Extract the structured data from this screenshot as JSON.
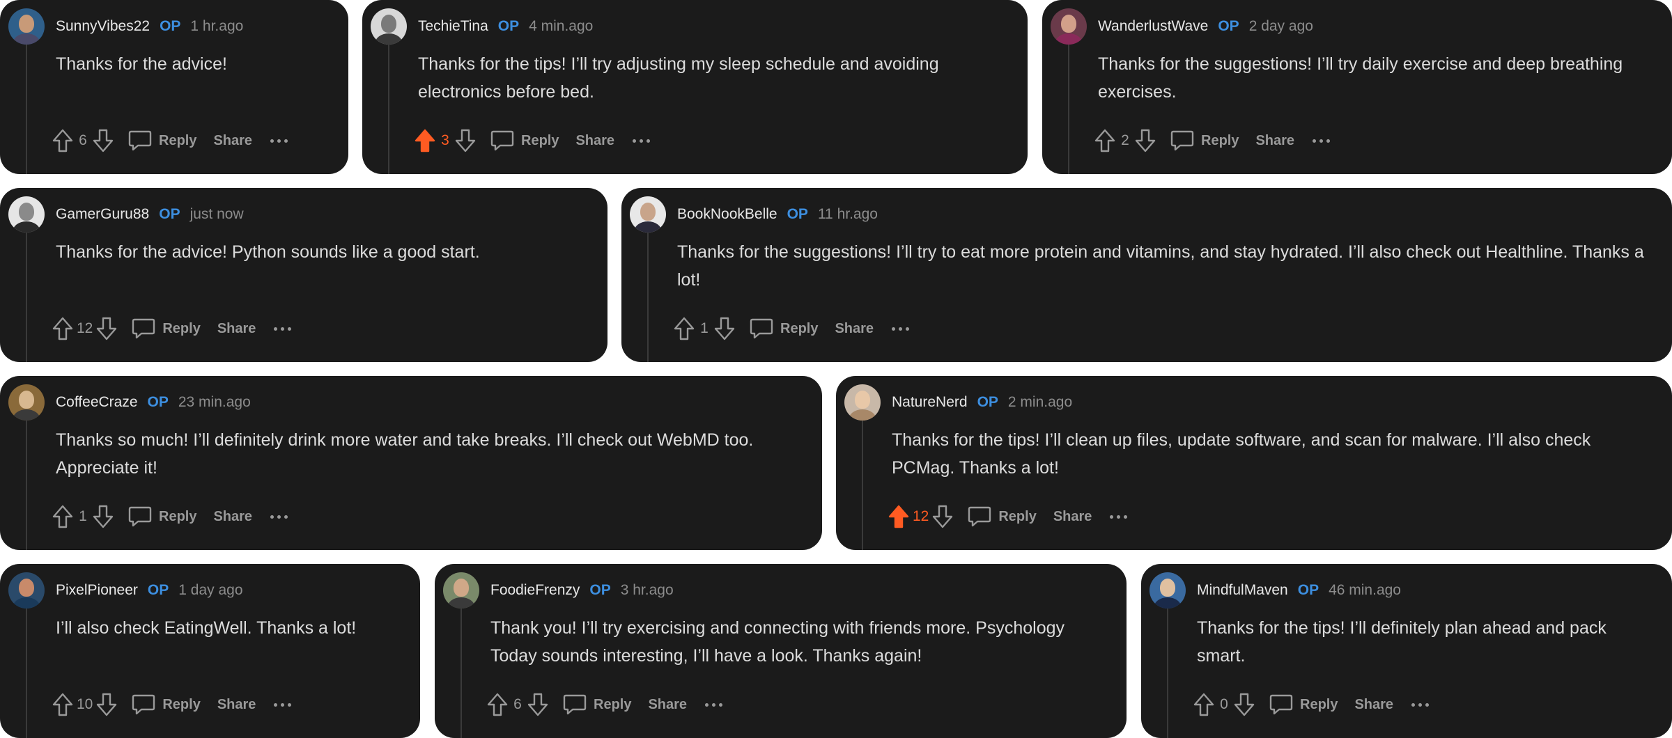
{
  "labels": {
    "op": "OP",
    "reply": "Reply",
    "share": "Share"
  },
  "colors": {
    "card_bg": "#1b1b1b",
    "op_badge": "#3d8fe0",
    "upvoted": "#ff5b22",
    "muted": "#9a9a9a"
  },
  "comments": [
    {
      "username": "SunnyVibes22",
      "time": "1 hr.ago",
      "text": "Thanks for the advice!",
      "votes": "6",
      "upvoted": false
    },
    {
      "username": "TechieTina",
      "time": "4 min.ago",
      "text": "Thanks for the tips! I’ll try adjusting my sleep schedule and avoiding electronics before bed.",
      "votes": "3",
      "upvoted": true
    },
    {
      "username": "WanderlustWave",
      "time": "2 day ago",
      "text": "Thanks for the suggestions! I’ll try daily exercise and deep breathing exercises.",
      "votes": "2",
      "upvoted": false
    },
    {
      "username": "GamerGuru88",
      "time": "just now",
      "text": "Thanks for the advice! Python sounds like a good start.",
      "votes": "12",
      "upvoted": false
    },
    {
      "username": "BookNookBelle",
      "time": "11 hr.ago",
      "text": "Thanks for the suggestions! I’ll try to eat more protein and vitamins, and stay hydrated. I’ll also check out Healthline. Thanks a lot!",
      "votes": "1",
      "upvoted": false
    },
    {
      "username": "CoffeeCraze",
      "time": "23 min.ago",
      "text": "Thanks so much! I’ll definitely drink more water and take breaks. I’ll check out WebMD too. Appreciate it!",
      "votes": "1",
      "upvoted": false
    },
    {
      "username": "NatureNerd",
      "time": "2 min.ago",
      "text": "Thanks for the tips! I’ll clean up files, update software, and scan for malware. I’ll also check PCMag. Thanks a lot!",
      "votes": "12",
      "upvoted": true
    },
    {
      "username": "PixelPioneer",
      "time": "1 day ago",
      "text": "I’ll also check EatingWell. Thanks a lot!",
      "votes": "10",
      "upvoted": false
    },
    {
      "username": "FoodieFrenzy",
      "time": "3 hr.ago",
      "text": "Thank you! I’ll try exercising and connecting with friends more. Psychology Today sounds interesting, I’ll have a look. Thanks again!",
      "votes": "6",
      "upvoted": false
    },
    {
      "username": "MindfulMaven",
      "time": "46 min.ago",
      "text": "Thanks for the tips! I’ll definitely plan ahead and pack smart.",
      "votes": "0",
      "upvoted": false
    }
  ]
}
